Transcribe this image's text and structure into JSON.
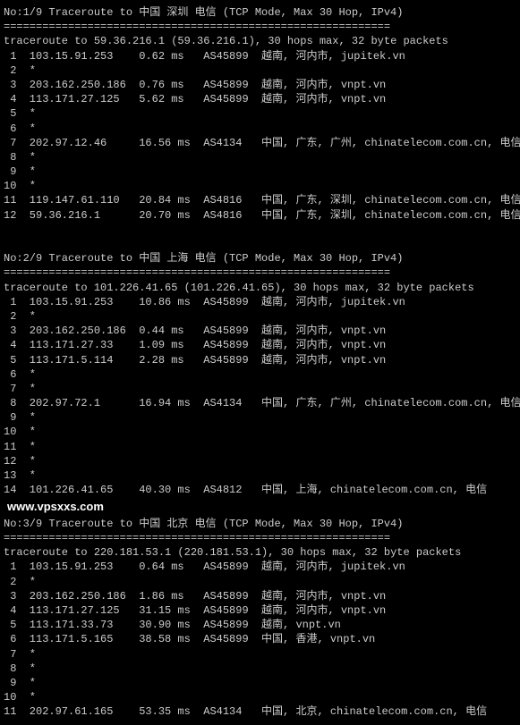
{
  "sep": "============================================================",
  "watermark": "www.vpsxxs.com",
  "blocks": [
    {
      "title": "No:1/9 Traceroute to 中国 深圳 电信 (TCP Mode, Max 30 Hop, IPv4)",
      "header": "traceroute to 59.36.216.1 (59.36.216.1), 30 hops max, 32 byte packets",
      "hops": [
        {
          "n": "1",
          "ip": "103.15.91.253",
          "ms": "0.62 ms",
          "asn": "AS45899",
          "loc": "越南, 河内市, jupitek.vn"
        },
        {
          "n": "2",
          "ip": "*",
          "ms": "",
          "asn": "",
          "loc": ""
        },
        {
          "n": "3",
          "ip": "203.162.250.186",
          "ms": "0.76 ms",
          "asn": "AS45899",
          "loc": "越南, 河内市, vnpt.vn"
        },
        {
          "n": "4",
          "ip": "113.171.27.125",
          "ms": "5.62 ms",
          "asn": "AS45899",
          "loc": "越南, 河内市, vnpt.vn"
        },
        {
          "n": "5",
          "ip": "*",
          "ms": "",
          "asn": "",
          "loc": ""
        },
        {
          "n": "6",
          "ip": "*",
          "ms": "",
          "asn": "",
          "loc": ""
        },
        {
          "n": "7",
          "ip": "202.97.12.46",
          "ms": "16.56 ms",
          "asn": "AS4134",
          "loc": "中国, 广东, 广州, chinatelecom.com.cn, 电信"
        },
        {
          "n": "8",
          "ip": "*",
          "ms": "",
          "asn": "",
          "loc": ""
        },
        {
          "n": "9",
          "ip": "*",
          "ms": "",
          "asn": "",
          "loc": ""
        },
        {
          "n": "10",
          "ip": "*",
          "ms": "",
          "asn": "",
          "loc": ""
        },
        {
          "n": "11",
          "ip": "119.147.61.110",
          "ms": "20.84 ms",
          "asn": "AS4816",
          "loc": "中国, 广东, 深圳, chinatelecom.com.cn, 电信"
        },
        {
          "n": "12",
          "ip": "59.36.216.1",
          "ms": "20.70 ms",
          "asn": "AS4816",
          "loc": "中国, 广东, 深圳, chinatelecom.com.cn, 电信"
        }
      ]
    },
    {
      "title": "No:2/9 Traceroute to 中国 上海 电信 (TCP Mode, Max 30 Hop, IPv4)",
      "header": "traceroute to 101.226.41.65 (101.226.41.65), 30 hops max, 32 byte packets",
      "hops": [
        {
          "n": "1",
          "ip": "103.15.91.253",
          "ms": "10.86 ms",
          "asn": "AS45899",
          "loc": "越南, 河内市, jupitek.vn"
        },
        {
          "n": "2",
          "ip": "*",
          "ms": "",
          "asn": "",
          "loc": ""
        },
        {
          "n": "3",
          "ip": "203.162.250.186",
          "ms": "0.44 ms",
          "asn": "AS45899",
          "loc": "越南, 河内市, vnpt.vn"
        },
        {
          "n": "4",
          "ip": "113.171.27.33",
          "ms": "1.09 ms",
          "asn": "AS45899",
          "loc": "越南, 河内市, vnpt.vn"
        },
        {
          "n": "5",
          "ip": "113.171.5.114",
          "ms": "2.28 ms",
          "asn": "AS45899",
          "loc": "越南, 河内市, vnpt.vn"
        },
        {
          "n": "6",
          "ip": "*",
          "ms": "",
          "asn": "",
          "loc": ""
        },
        {
          "n": "7",
          "ip": "*",
          "ms": "",
          "asn": "",
          "loc": ""
        },
        {
          "n": "8",
          "ip": "202.97.72.1",
          "ms": "16.94 ms",
          "asn": "AS4134",
          "loc": "中国, 广东, 广州, chinatelecom.com.cn, 电信"
        },
        {
          "n": "9",
          "ip": "*",
          "ms": "",
          "asn": "",
          "loc": ""
        },
        {
          "n": "10",
          "ip": "*",
          "ms": "",
          "asn": "",
          "loc": ""
        },
        {
          "n": "11",
          "ip": "*",
          "ms": "",
          "asn": "",
          "loc": ""
        },
        {
          "n": "12",
          "ip": "*",
          "ms": "",
          "asn": "",
          "loc": ""
        },
        {
          "n": "13",
          "ip": "*",
          "ms": "",
          "asn": "",
          "loc": ""
        },
        {
          "n": "14",
          "ip": "101.226.41.65",
          "ms": "40.30 ms",
          "asn": "AS4812",
          "loc": "中国, 上海, chinatelecom.com.cn, 电信"
        }
      ]
    },
    {
      "title": "No:3/9 Traceroute to 中国 北京 电信 (TCP Mode, Max 30 Hop, IPv4)",
      "header": "traceroute to 220.181.53.1 (220.181.53.1), 30 hops max, 32 byte packets",
      "hops": [
        {
          "n": "1",
          "ip": "103.15.91.253",
          "ms": "0.64 ms",
          "asn": "AS45899",
          "loc": "越南, 河内市, jupitek.vn"
        },
        {
          "n": "2",
          "ip": "*",
          "ms": "",
          "asn": "",
          "loc": ""
        },
        {
          "n": "3",
          "ip": "203.162.250.186",
          "ms": "1.86 ms",
          "asn": "AS45899",
          "loc": "越南, 河内市, vnpt.vn"
        },
        {
          "n": "4",
          "ip": "113.171.27.125",
          "ms": "31.15 ms",
          "asn": "AS45899",
          "loc": "越南, 河内市, vnpt.vn"
        },
        {
          "n": "5",
          "ip": "113.171.33.73",
          "ms": "30.90 ms",
          "asn": "AS45899",
          "loc": "越南, vnpt.vn"
        },
        {
          "n": "6",
          "ip": "113.171.5.165",
          "ms": "38.58 ms",
          "asn": "AS45899",
          "loc": "中国, 香港, vnpt.vn"
        },
        {
          "n": "7",
          "ip": "*",
          "ms": "",
          "asn": "",
          "loc": ""
        },
        {
          "n": "8",
          "ip": "*",
          "ms": "",
          "asn": "",
          "loc": ""
        },
        {
          "n": "9",
          "ip": "*",
          "ms": "",
          "asn": "",
          "loc": ""
        },
        {
          "n": "10",
          "ip": "*",
          "ms": "",
          "asn": "",
          "loc": ""
        },
        {
          "n": "11",
          "ip": "202.97.61.165",
          "ms": "53.35 ms",
          "asn": "AS4134",
          "loc": "中国, 北京, chinatelecom.com.cn, 电信"
        }
      ]
    }
  ]
}
